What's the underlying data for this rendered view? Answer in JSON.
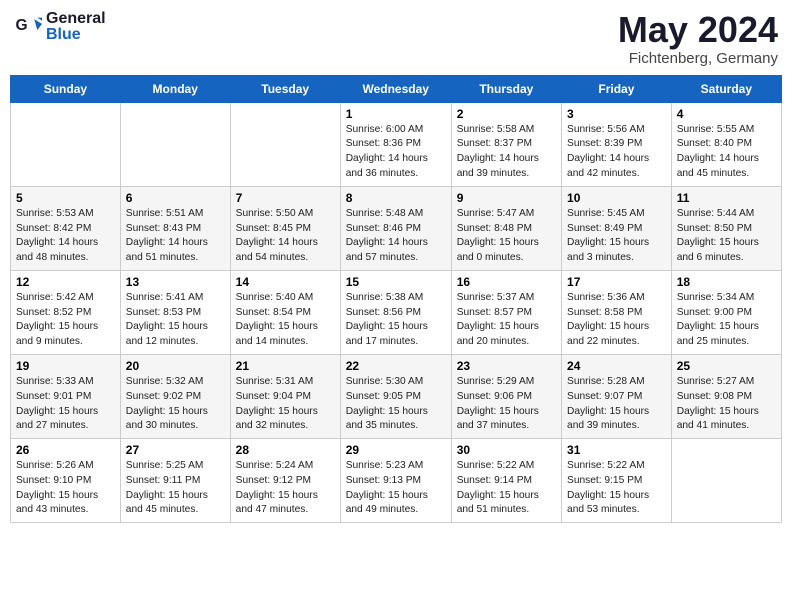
{
  "header": {
    "logo_general": "General",
    "logo_blue": "Blue",
    "month": "May 2024",
    "location": "Fichtenberg, Germany"
  },
  "days_of_week": [
    "Sunday",
    "Monday",
    "Tuesday",
    "Wednesday",
    "Thursday",
    "Friday",
    "Saturday"
  ],
  "weeks": [
    [
      {
        "day": "",
        "info": ""
      },
      {
        "day": "",
        "info": ""
      },
      {
        "day": "",
        "info": ""
      },
      {
        "day": "1",
        "info": "Sunrise: 6:00 AM\nSunset: 8:36 PM\nDaylight: 14 hours\nand 36 minutes."
      },
      {
        "day": "2",
        "info": "Sunrise: 5:58 AM\nSunset: 8:37 PM\nDaylight: 14 hours\nand 39 minutes."
      },
      {
        "day": "3",
        "info": "Sunrise: 5:56 AM\nSunset: 8:39 PM\nDaylight: 14 hours\nand 42 minutes."
      },
      {
        "day": "4",
        "info": "Sunrise: 5:55 AM\nSunset: 8:40 PM\nDaylight: 14 hours\nand 45 minutes."
      }
    ],
    [
      {
        "day": "5",
        "info": "Sunrise: 5:53 AM\nSunset: 8:42 PM\nDaylight: 14 hours\nand 48 minutes."
      },
      {
        "day": "6",
        "info": "Sunrise: 5:51 AM\nSunset: 8:43 PM\nDaylight: 14 hours\nand 51 minutes."
      },
      {
        "day": "7",
        "info": "Sunrise: 5:50 AM\nSunset: 8:45 PM\nDaylight: 14 hours\nand 54 minutes."
      },
      {
        "day": "8",
        "info": "Sunrise: 5:48 AM\nSunset: 8:46 PM\nDaylight: 14 hours\nand 57 minutes."
      },
      {
        "day": "9",
        "info": "Sunrise: 5:47 AM\nSunset: 8:48 PM\nDaylight: 15 hours\nand 0 minutes."
      },
      {
        "day": "10",
        "info": "Sunrise: 5:45 AM\nSunset: 8:49 PM\nDaylight: 15 hours\nand 3 minutes."
      },
      {
        "day": "11",
        "info": "Sunrise: 5:44 AM\nSunset: 8:50 PM\nDaylight: 15 hours\nand 6 minutes."
      }
    ],
    [
      {
        "day": "12",
        "info": "Sunrise: 5:42 AM\nSunset: 8:52 PM\nDaylight: 15 hours\nand 9 minutes."
      },
      {
        "day": "13",
        "info": "Sunrise: 5:41 AM\nSunset: 8:53 PM\nDaylight: 15 hours\nand 12 minutes."
      },
      {
        "day": "14",
        "info": "Sunrise: 5:40 AM\nSunset: 8:54 PM\nDaylight: 15 hours\nand 14 minutes."
      },
      {
        "day": "15",
        "info": "Sunrise: 5:38 AM\nSunset: 8:56 PM\nDaylight: 15 hours\nand 17 minutes."
      },
      {
        "day": "16",
        "info": "Sunrise: 5:37 AM\nSunset: 8:57 PM\nDaylight: 15 hours\nand 20 minutes."
      },
      {
        "day": "17",
        "info": "Sunrise: 5:36 AM\nSunset: 8:58 PM\nDaylight: 15 hours\nand 22 minutes."
      },
      {
        "day": "18",
        "info": "Sunrise: 5:34 AM\nSunset: 9:00 PM\nDaylight: 15 hours\nand 25 minutes."
      }
    ],
    [
      {
        "day": "19",
        "info": "Sunrise: 5:33 AM\nSunset: 9:01 PM\nDaylight: 15 hours\nand 27 minutes."
      },
      {
        "day": "20",
        "info": "Sunrise: 5:32 AM\nSunset: 9:02 PM\nDaylight: 15 hours\nand 30 minutes."
      },
      {
        "day": "21",
        "info": "Sunrise: 5:31 AM\nSunset: 9:04 PM\nDaylight: 15 hours\nand 32 minutes."
      },
      {
        "day": "22",
        "info": "Sunrise: 5:30 AM\nSunset: 9:05 PM\nDaylight: 15 hours\nand 35 minutes."
      },
      {
        "day": "23",
        "info": "Sunrise: 5:29 AM\nSunset: 9:06 PM\nDaylight: 15 hours\nand 37 minutes."
      },
      {
        "day": "24",
        "info": "Sunrise: 5:28 AM\nSunset: 9:07 PM\nDaylight: 15 hours\nand 39 minutes."
      },
      {
        "day": "25",
        "info": "Sunrise: 5:27 AM\nSunset: 9:08 PM\nDaylight: 15 hours\nand 41 minutes."
      }
    ],
    [
      {
        "day": "26",
        "info": "Sunrise: 5:26 AM\nSunset: 9:10 PM\nDaylight: 15 hours\nand 43 minutes."
      },
      {
        "day": "27",
        "info": "Sunrise: 5:25 AM\nSunset: 9:11 PM\nDaylight: 15 hours\nand 45 minutes."
      },
      {
        "day": "28",
        "info": "Sunrise: 5:24 AM\nSunset: 9:12 PM\nDaylight: 15 hours\nand 47 minutes."
      },
      {
        "day": "29",
        "info": "Sunrise: 5:23 AM\nSunset: 9:13 PM\nDaylight: 15 hours\nand 49 minutes."
      },
      {
        "day": "30",
        "info": "Sunrise: 5:22 AM\nSunset: 9:14 PM\nDaylight: 15 hours\nand 51 minutes."
      },
      {
        "day": "31",
        "info": "Sunrise: 5:22 AM\nSunset: 9:15 PM\nDaylight: 15 hours\nand 53 minutes."
      },
      {
        "day": "",
        "info": ""
      }
    ]
  ]
}
